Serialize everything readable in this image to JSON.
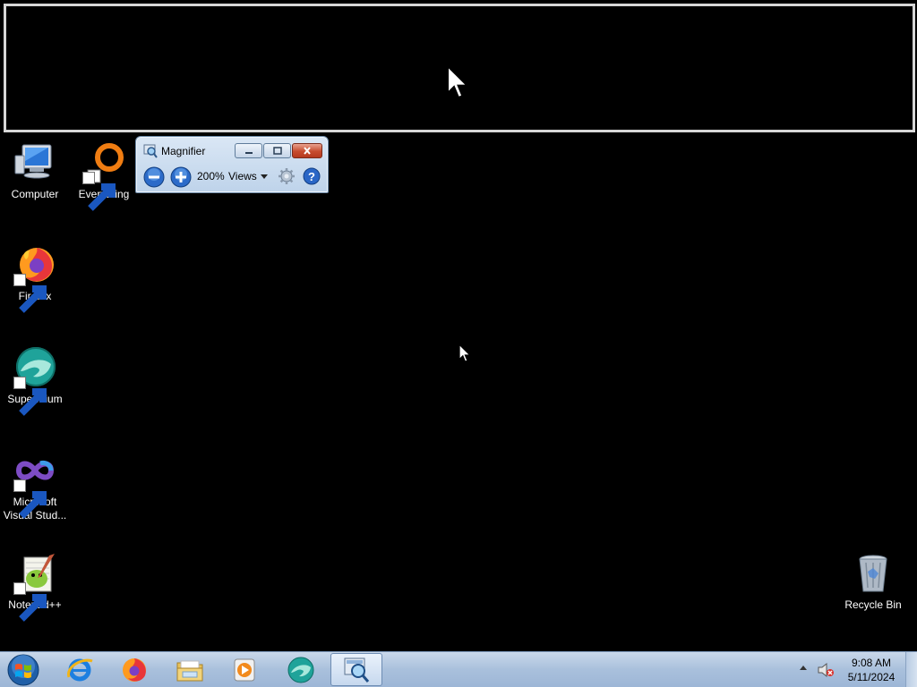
{
  "magnifier": {
    "title": "Magnifier",
    "zoom_level": "200%",
    "views_label": "Views",
    "buttons": {
      "minimize": "minimize-icon",
      "maximize": "maximize-icon",
      "close": "close-icon",
      "zoom_out": "zoom-out-icon",
      "zoom_in": "zoom-in-icon",
      "options": "gear-icon",
      "help": "help-icon"
    }
  },
  "desktop": {
    "icons": [
      {
        "label": "Computer",
        "icon": "computer-icon"
      },
      {
        "label": "Everything",
        "icon": "everything-search-icon"
      },
      {
        "label": "Firefox",
        "icon": "firefox-icon"
      },
      {
        "label": "Supermium",
        "icon": "supermium-icon"
      },
      {
        "label": "Microsoft Visual Stud...",
        "icon": "visual-studio-icon"
      },
      {
        "label": "Notepad++",
        "icon": "notepad-plus-plus-icon"
      },
      {
        "label": "Recycle Bin",
        "icon": "recycle-bin-icon"
      }
    ]
  },
  "taskbar": {
    "items": [
      {
        "name": "start-button",
        "icon": "windows-logo-icon"
      },
      {
        "name": "internet-explorer",
        "icon": "internet-explorer-icon"
      },
      {
        "name": "firefox",
        "icon": "firefox-icon"
      },
      {
        "name": "file-explorer",
        "icon": "folder-icon"
      },
      {
        "name": "media-player",
        "icon": "media-player-icon"
      },
      {
        "name": "supermium",
        "icon": "supermium-icon"
      },
      {
        "name": "magnifier",
        "icon": "magnifier-icon",
        "active": true
      }
    ],
    "tray": {
      "volume_icon": "volume-muted-icon"
    },
    "clock": {
      "time": "9:08 AM",
      "date": "5/11/2024"
    }
  },
  "colors": {
    "desktop_background": "#000000",
    "taskbar": "#a9c0dc",
    "magnifier_window": "#cfe0f3",
    "close_button": "#c74c2f"
  }
}
